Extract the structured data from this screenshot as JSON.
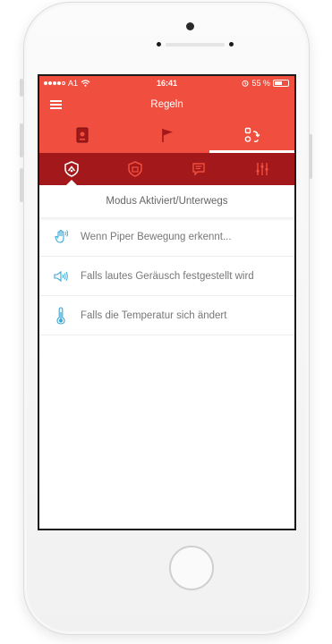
{
  "status_bar": {
    "carrier": "A1",
    "time": "16:41",
    "battery": "55 %",
    "signal_dots_filled": 4,
    "battery_level": 0.55
  },
  "nav": {
    "title": "Regeln"
  },
  "top_tabs": [
    {
      "icon": "device-icon",
      "active": false
    },
    {
      "icon": "flag-icon",
      "active": false
    },
    {
      "icon": "rules-switch-icon",
      "active": true
    }
  ],
  "sub_tabs": [
    {
      "icon": "shield-mode-icon",
      "active": true
    },
    {
      "icon": "home-shield-icon",
      "active": false
    },
    {
      "icon": "message-icon",
      "active": false
    },
    {
      "icon": "sliders-icon",
      "active": false
    }
  ],
  "mode_header": "Modus Aktiviert/Unterwegs",
  "rules": [
    {
      "icon": "motion-hand-icon",
      "label": "Wenn Piper Bewegung erkennt..."
    },
    {
      "icon": "speaker-sound-icon",
      "label": "Falls lautes Geräusch festgestellt wird"
    },
    {
      "icon": "thermometer-icon",
      "label": "Falls die Temperatur sich ändert"
    }
  ],
  "colors": {
    "primary_red": "#f04e3e",
    "dark_red": "#a3181a",
    "icon_blue": "#3aa7d6"
  }
}
